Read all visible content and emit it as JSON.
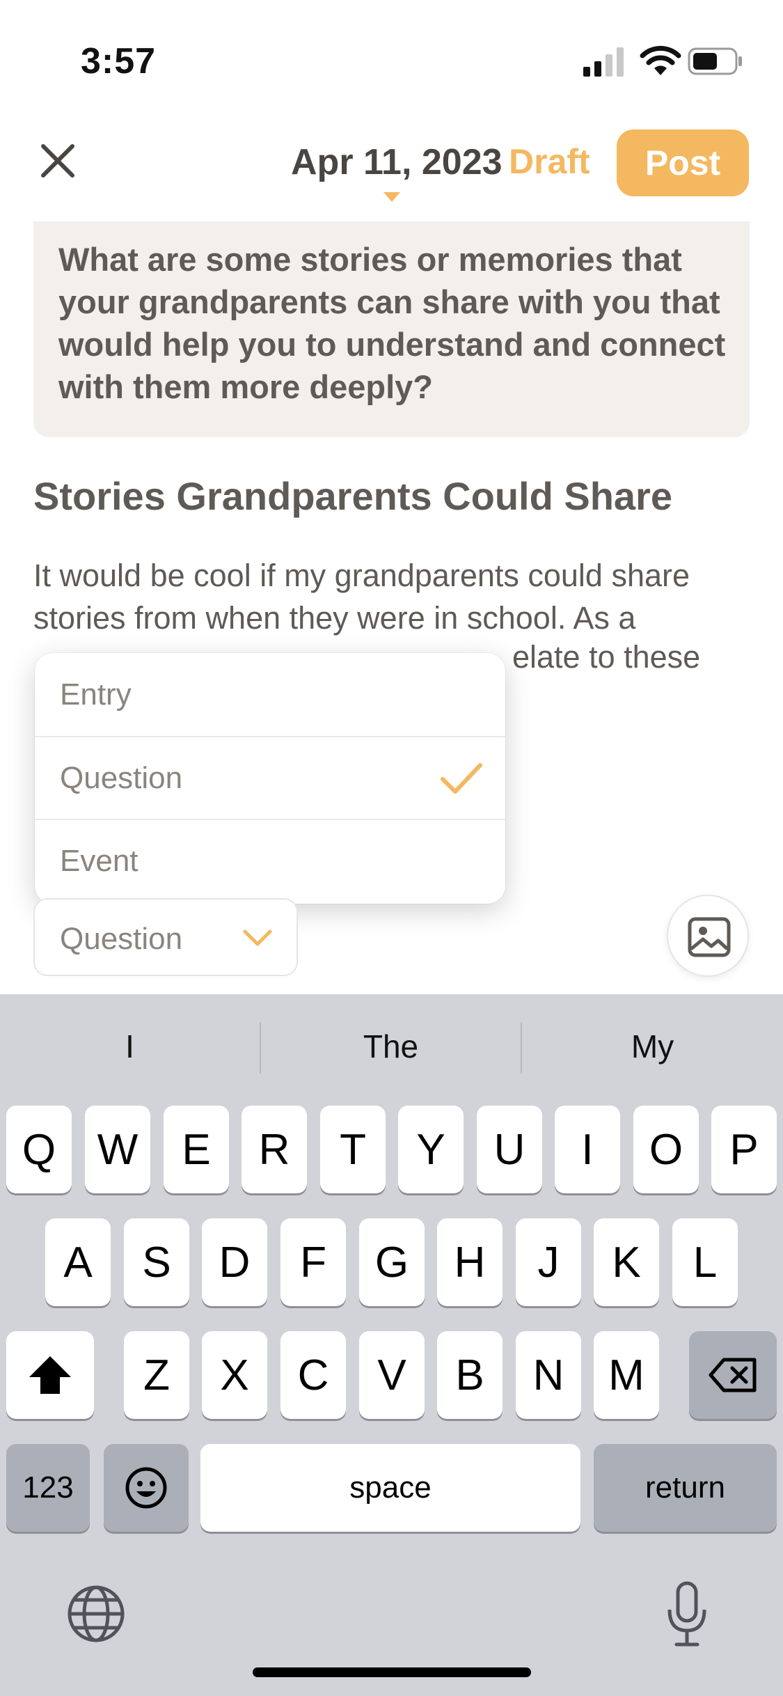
{
  "status_bar": {
    "time": "3:57"
  },
  "header": {
    "date": "Apr 11, 2023",
    "status": "Draft",
    "post_label": "Post"
  },
  "prompt": {
    "text": "What are some stories or memories that your grandparents can share with you that would help you to understand and connect with them more deeply?"
  },
  "entry": {
    "title": "Stories Grandparents Could Share",
    "body": "It would be cool if my grandparents could share stories from when they were in school. As a"
  },
  "type_menu": {
    "items": [
      "Entry",
      "Question",
      "Event"
    ],
    "selected": "Question",
    "partial_text": "elate to these"
  },
  "type_select": {
    "value": "Question"
  },
  "keyboard": {
    "suggestions": [
      "I",
      "The",
      "My"
    ],
    "row1": [
      "Q",
      "W",
      "E",
      "R",
      "T",
      "Y",
      "U",
      "I",
      "O",
      "P"
    ],
    "row2": [
      "A",
      "S",
      "D",
      "F",
      "G",
      "H",
      "J",
      "K",
      "L"
    ],
    "row3": [
      "Z",
      "X",
      "C",
      "V",
      "B",
      "N",
      "M"
    ],
    "numbers_label": "123",
    "space_label": "space",
    "return_label": "return"
  },
  "colors": {
    "accent": "#f4b860",
    "text": "#5f5a55",
    "card": "#f3f0ec",
    "keyboard": "#d1d3d9"
  }
}
